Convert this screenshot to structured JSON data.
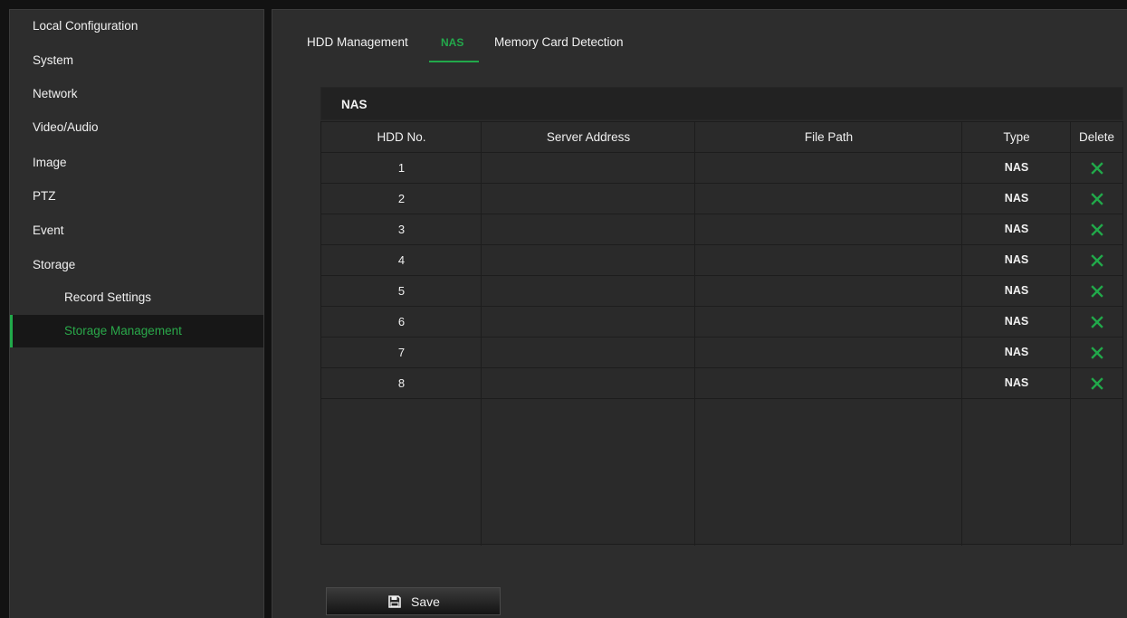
{
  "sidebar": {
    "items": [
      {
        "label": "Local Configuration"
      },
      {
        "label": "System"
      },
      {
        "label": "Network"
      },
      {
        "label": "Video/Audio"
      },
      {
        "label": "Image"
      },
      {
        "label": "PTZ"
      },
      {
        "label": "Event"
      },
      {
        "label": "Storage"
      },
      {
        "label": "Record Settings"
      },
      {
        "label": "Storage Management"
      }
    ]
  },
  "tabs": [
    {
      "label": "HDD Management"
    },
    {
      "label": "NAS"
    },
    {
      "label": "Memory Card Detection"
    }
  ],
  "panel": {
    "title": "NAS",
    "columns": [
      "HDD No.",
      "Server Address",
      "File Path",
      "Type",
      "Delete"
    ],
    "rows": [
      {
        "hdd_no": "1",
        "server_address": "",
        "file_path": "",
        "type": "NAS"
      },
      {
        "hdd_no": "2",
        "server_address": "",
        "file_path": "",
        "type": "NAS"
      },
      {
        "hdd_no": "3",
        "server_address": "",
        "file_path": "",
        "type": "NAS"
      },
      {
        "hdd_no": "4",
        "server_address": "",
        "file_path": "",
        "type": "NAS"
      },
      {
        "hdd_no": "5",
        "server_address": "",
        "file_path": "",
        "type": "NAS"
      },
      {
        "hdd_no": "6",
        "server_address": "",
        "file_path": "",
        "type": "NAS"
      },
      {
        "hdd_no": "7",
        "server_address": "",
        "file_path": "",
        "type": "NAS"
      },
      {
        "hdd_no": "8",
        "server_address": "",
        "file_path": "",
        "type": "NAS"
      }
    ],
    "delete_icon": "close-icon"
  },
  "save": {
    "label": "Save",
    "icon": "save-icon"
  },
  "colors": {
    "accent": "#21a94a",
    "background": "#2d2d2d",
    "page": "#121212"
  }
}
